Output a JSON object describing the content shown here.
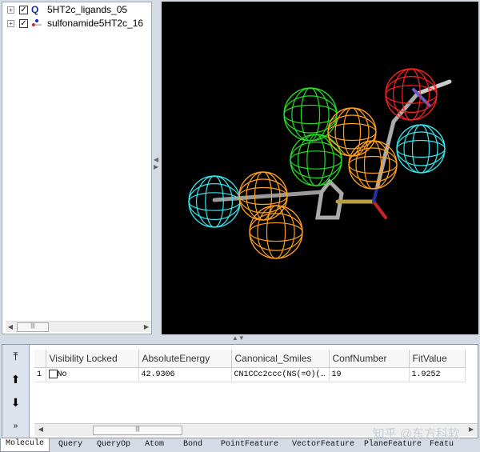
{
  "tree": {
    "items": [
      {
        "label": "5HT2c_ligands_05",
        "icon": "query-icon",
        "icon_glyph": "Q",
        "checked": true
      },
      {
        "label": "sulfonamide5HT2c_16",
        "icon": "molecule-icon",
        "checked": true
      }
    ]
  },
  "grid": {
    "columns": [
      "",
      "Visibility Locked",
      "AbsoluteEnergy",
      "Canonical_Smiles",
      "ConfNumber",
      "FitValue"
    ],
    "rows": [
      {
        "index": "1",
        "visibility": "No",
        "absolute_energy": "42.9306",
        "smiles": "CN1CCc2ccc(NS(=O)(…",
        "conf_number": "19",
        "fit_value": "1.9252"
      }
    ]
  },
  "watermark": "知乎 @东方科软",
  "tabs": [
    "Molecule",
    "Query",
    "QueryOp",
    "Atom",
    "Bond",
    "PointFeature",
    "VectorFeature",
    "PlaneFeature",
    "Featu"
  ],
  "colors": {
    "hydrophobic": "#ff9f1a",
    "acceptor": "#22e022",
    "donor": "#ff2020",
    "aromatic": "#33e6f0"
  }
}
